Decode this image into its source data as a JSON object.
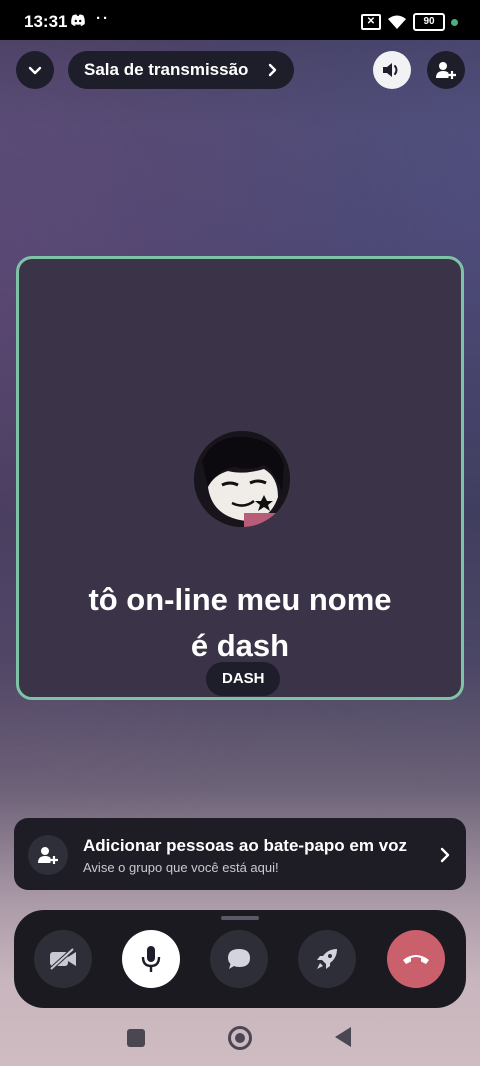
{
  "status_bar": {
    "time": "13:31",
    "dots": "··",
    "battery": "90"
  },
  "header": {
    "title": "Sala de transmissão",
    "back_icon": "chevron-down-icon",
    "speaker_icon": "speaker-icon",
    "add_user_icon": "add-user-icon"
  },
  "stream": {
    "overlay_text_line1": "tô on-line meu nome",
    "overlay_text_line2": "é  dash",
    "user_name": "DASH",
    "border_color": "#7fc3a6"
  },
  "invite_card": {
    "title": "Adicionar pessoas ao bate-papo em voz",
    "subtitle": "Avise o grupo que você está aqui!"
  },
  "controls": {
    "buttons": [
      "camera-off-icon",
      "microphone-icon",
      "chat-icon",
      "rocket-icon",
      "hang-up-icon"
    ],
    "hangup_color": "#c9606c"
  }
}
